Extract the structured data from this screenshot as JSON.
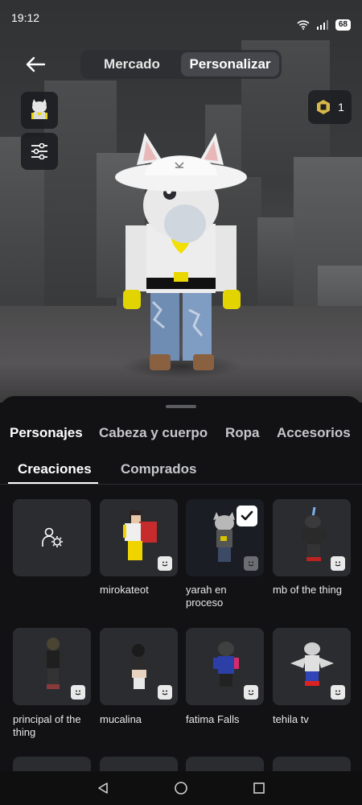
{
  "status": {
    "time": "19:12",
    "battery": "68"
  },
  "nav": {
    "tabs": [
      "Mercado",
      "Personalizar"
    ],
    "active": 1
  },
  "robux": {
    "count": "1"
  },
  "categories": [
    "Personajes",
    "Cabeza y cuerpo",
    "Ropa",
    "Accesorios"
  ],
  "subtabs": [
    "Creaciones",
    "Comprados"
  ],
  "characters": [
    {
      "name": "mirokateot"
    },
    {
      "name": "yarah en proceso",
      "selected": true
    },
    {
      "name": "mb of the thing"
    },
    {
      "name": "principal of the thing"
    },
    {
      "name": "mucalina"
    },
    {
      "name": "fatima Falls"
    },
    {
      "name": "tehila tv"
    }
  ],
  "colors": {
    "sheet": "#121214",
    "tile": "#2b2c30",
    "accent": "#ffffff"
  }
}
